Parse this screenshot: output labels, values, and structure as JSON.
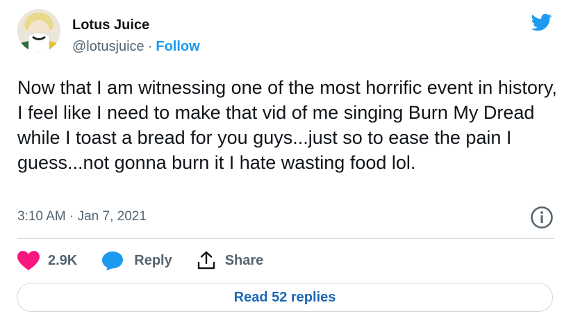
{
  "author": {
    "name": "Lotus Juice",
    "handle": "@lotusjuice",
    "separator": "·",
    "follow_label": "Follow"
  },
  "tweet": {
    "text": "Now that I am witnessing one of the most horrific event in history, I feel like I need to make that vid of me singing Burn My Dread while I toast a bread for you guys...just so to ease the pain I guess...not gonna burn it I hate wasting food lol.",
    "time": "3:10 AM",
    "separator": "·",
    "date": "Jan 7, 2021"
  },
  "actions": {
    "likes": "2.9K",
    "reply_label": "Reply",
    "share_label": "Share"
  },
  "read_replies_label": "Read 52 replies",
  "icons": [
    "twitter-bird-icon",
    "info-icon",
    "heart-icon",
    "reply-bubble-icon",
    "share-icon"
  ],
  "colors": {
    "text": "#0f1419",
    "secondary": "#536471",
    "twitter_blue": "#1d9bf0",
    "like_pink": "#f91880",
    "divider": "#cfd9de"
  }
}
